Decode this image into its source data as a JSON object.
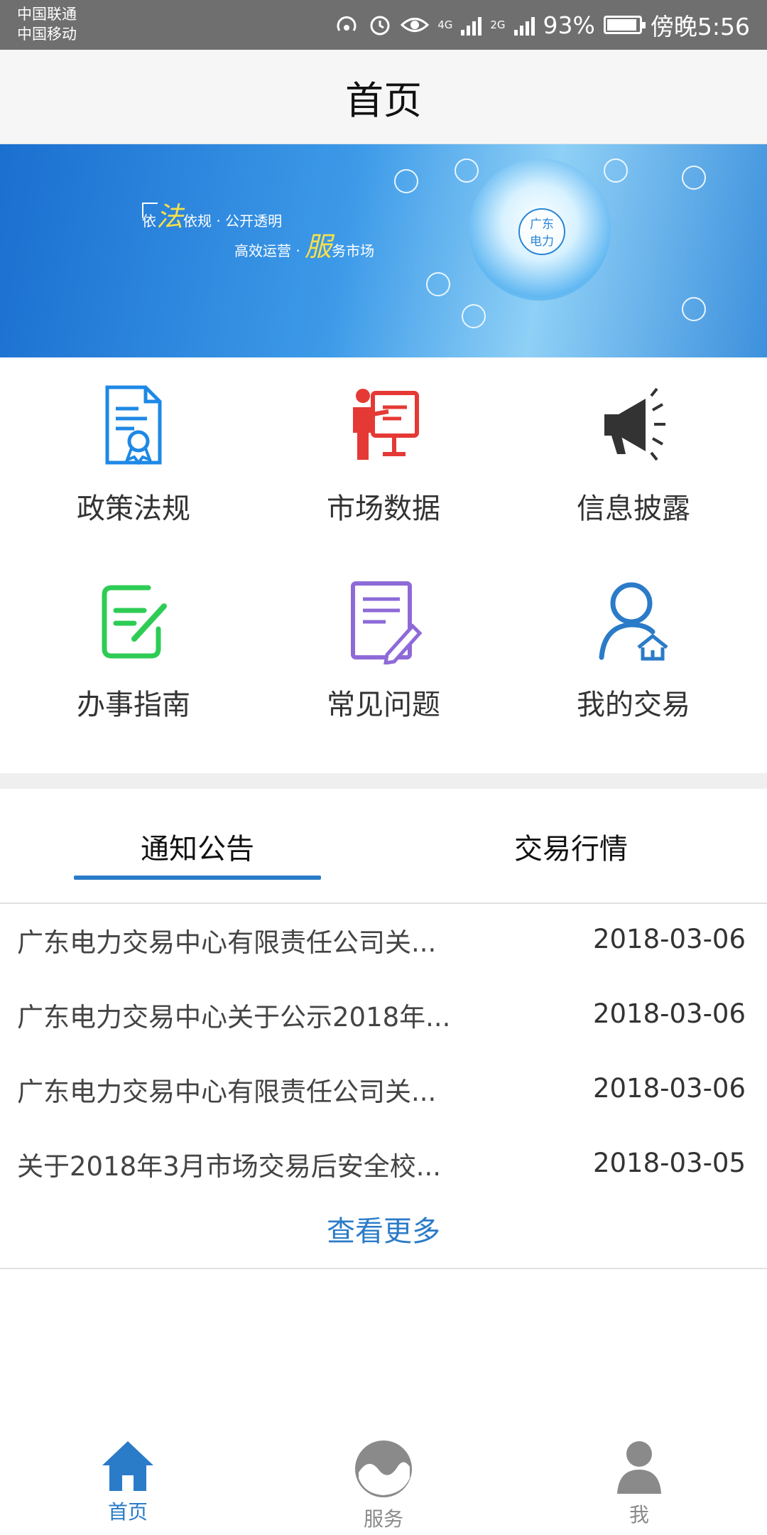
{
  "status_bar": {
    "carrier_1": "中国联通",
    "carrier_2": "中国移动",
    "network_1": "4G",
    "network_2": "2G",
    "battery": "93%",
    "time": "傍晚5:56"
  },
  "nav": {
    "title": "首页"
  },
  "banner": {
    "slogan_line1_prefix": "依",
    "slogan_line1_highlight": "法",
    "slogan_line1_suffix": "依规 · 公开透明",
    "slogan_line2_prefix": "高效运营 · ",
    "slogan_line2_highlight": "服",
    "slogan_line2_suffix": "务市场",
    "logo_text_1": "广东",
    "logo_text_2": "电力"
  },
  "grid": {
    "items": [
      {
        "label": "政策法规",
        "icon": "certificate-document-icon",
        "color": "#1e88e5"
      },
      {
        "label": "市场数据",
        "icon": "presenter-board-icon",
        "color": "#e53935"
      },
      {
        "label": "信息披露",
        "icon": "megaphone-icon",
        "color": "#333333"
      },
      {
        "label": "办事指南",
        "icon": "edit-note-icon",
        "color": "#2ecc55"
      },
      {
        "label": "常见问题",
        "icon": "notepad-pencil-icon",
        "color": "#8e6ad8"
      },
      {
        "label": "我的交易",
        "icon": "user-house-icon",
        "color": "#2a7bc8"
      }
    ]
  },
  "tabs": {
    "items": [
      {
        "label": "通知公告",
        "active": true
      },
      {
        "label": "交易行情",
        "active": false
      }
    ],
    "accent": "#2a7bc8"
  },
  "news": {
    "rows": [
      {
        "title": "广东电力交易中心有限责任公司关...",
        "date": "2018-03-06"
      },
      {
        "title": "广东电力交易中心关于公示2018年...",
        "date": "2018-03-06"
      },
      {
        "title": "广东电力交易中心有限责任公司关...",
        "date": "2018-03-06"
      },
      {
        "title": "关于2018年3月市场交易后安全校...",
        "date": "2018-03-05"
      }
    ],
    "more_label": "查看更多"
  },
  "bottom_nav": {
    "items": [
      {
        "label": "首页",
        "icon": "home-icon",
        "active": true,
        "color": "#2a7bc8"
      },
      {
        "label": "服务",
        "icon": "service-globe-icon",
        "active": false,
        "color": "#8a8a8a"
      },
      {
        "label": "我",
        "icon": "person-icon",
        "active": false,
        "color": "#8a8a8a"
      }
    ]
  }
}
